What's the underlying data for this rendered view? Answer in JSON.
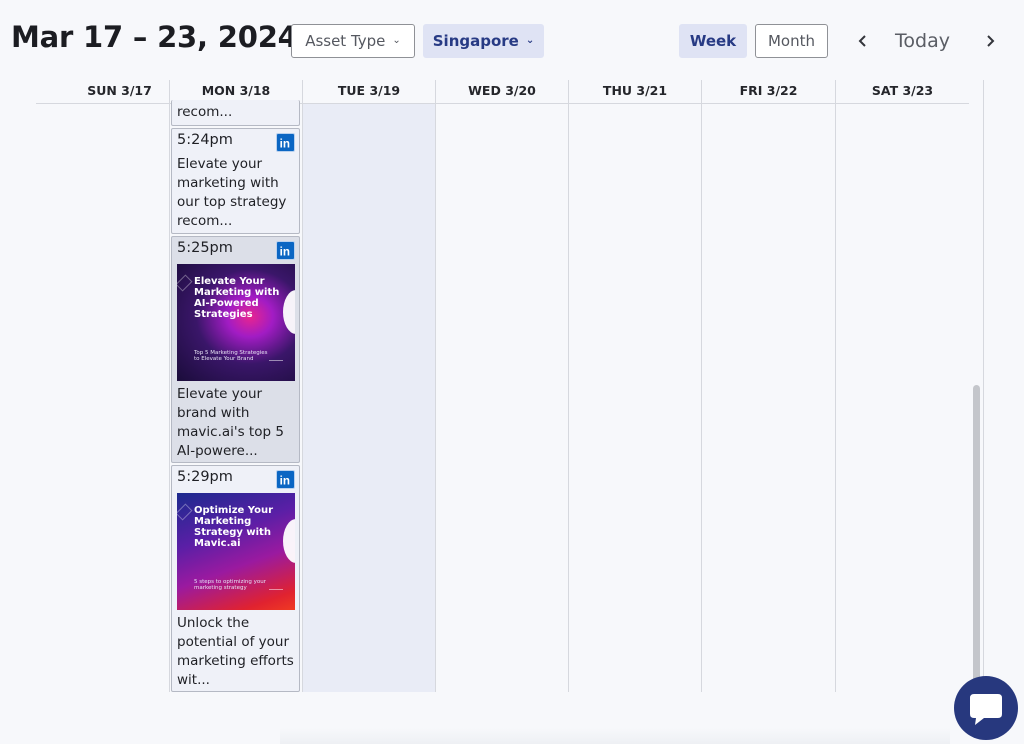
{
  "header": {
    "date_range": "Mar 17 – 23, 2024",
    "asset_type_label": "Asset Type",
    "region_label": "Singapore",
    "view_week_label": "Week",
    "view_month_label": "Month",
    "today_label": "Today",
    "active_view": "Week"
  },
  "icons": {
    "prev": "chevron-left-icon",
    "next": "chevron-right-icon",
    "dropdown": "chevron-down-icon",
    "social": "linkedin-icon",
    "chat": "chat-icon"
  },
  "calendar": {
    "days": [
      {
        "label": "SUN 3/17"
      },
      {
        "label": "MON 3/18"
      },
      {
        "label": "TUE 3/19"
      },
      {
        "label": "WED 3/20"
      },
      {
        "label": "THU 3/21"
      },
      {
        "label": "FRI 3/22"
      },
      {
        "label": "SAT 3/23"
      }
    ],
    "highlighted_day": "TUE 3/19"
  },
  "posts": [
    {
      "time": "",
      "text": "recom...",
      "platform": "LinkedIn"
    },
    {
      "time": "5:24pm",
      "text": "Elevate your marketing with our top strategy recom...",
      "platform": "LinkedIn"
    },
    {
      "time": "5:25pm",
      "text": "Elevate your brand with mavic.ai's top 5 AI-powere...",
      "platform": "LinkedIn",
      "image": {
        "title": "Elevate Your Marketing with AI-Powered Strategies",
        "subtitle": "Top 5 Marketing Strategies to Elevate Your Brand"
      }
    },
    {
      "time": "5:29pm",
      "text": "Unlock the potential of your marketing efforts wit...",
      "platform": "LinkedIn",
      "image": {
        "title": "Optimize Your Marketing Strategy with Mavic.ai",
        "subtitle": "5 steps to optimizing your marketing strategy"
      }
    }
  ],
  "colors": {
    "accent": "#273a84",
    "linkedin": "#0b66c3",
    "highlight_column": "#e9ecf6",
    "chat_button": "#27387e"
  }
}
